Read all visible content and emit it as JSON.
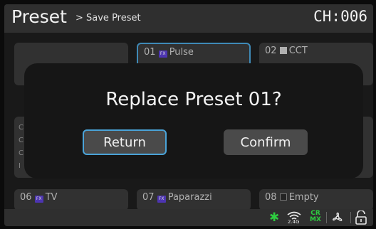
{
  "header": {
    "title": "Preset",
    "breadcrumb": "> Save Preset",
    "channel": "CH:006"
  },
  "presets": [
    {
      "label": "",
      "selected": false
    },
    {
      "number": "01",
      "name": "Pulse",
      "type": "fx",
      "selected": true
    },
    {
      "number": "02",
      "name": "CCT",
      "type": "cct",
      "selected": false
    },
    {
      "number": "06",
      "name": "TV",
      "type": "fx",
      "selected": false
    },
    {
      "number": "07",
      "name": "Paparazzi",
      "type": "fx",
      "selected": false
    },
    {
      "number": "08",
      "name": "Empty",
      "type": "empty",
      "selected": false
    }
  ],
  "tile_labels": {
    "t1": "01 Pulse",
    "t2": "02 CCT",
    "t6": "06 TV",
    "t7": "07 Paparazzi",
    "t8": "08 Empty"
  },
  "dialog": {
    "question": "Replace Preset 01?",
    "return_label": "Return",
    "confirm_label": "Confirm"
  },
  "status": {
    "bluetooth_icon": "bluetooth-icon",
    "wifi_band": "2.4G",
    "crmx": "CR MX",
    "fan_icon": "fan-icon",
    "lock_icon": "unlock-icon"
  },
  "colors": {
    "accent": "#4aa3d8",
    "fx_badge": "#5b3fd0",
    "status_green": "#2ecc40"
  }
}
